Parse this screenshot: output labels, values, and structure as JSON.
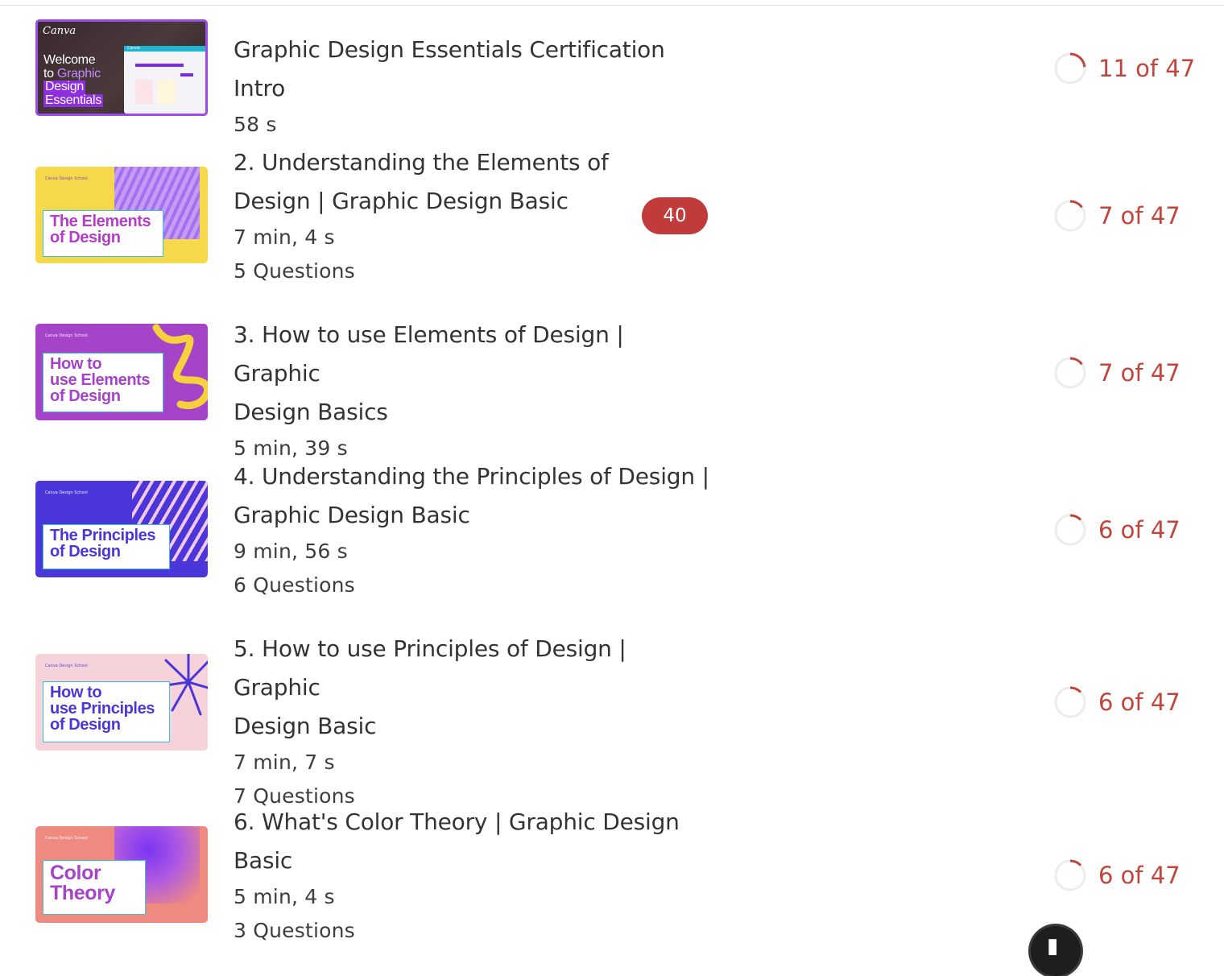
{
  "lessons": [
    {
      "title": "Graphic Design Essentials Certification Intro",
      "duration": "58 s",
      "questions": "",
      "badge": "",
      "progress_text": "11 of 47",
      "progress_fraction": 0.234,
      "thumb": {
        "brand": "Canva",
        "line1": "Welcome",
        "line2a": "to ",
        "line2b": "Graphic",
        "line3": "Design",
        "line4": "Essentials",
        "mini_brand": "Canva"
      }
    },
    {
      "title": "2. Understanding the Elements of Design | Graphic Design Basic",
      "title_line1": "2. Understanding the Elements of",
      "title_line2": "Design | Graphic Design Basic",
      "duration": "7 min, 4 s",
      "questions": "5 Questions",
      "badge": "40",
      "progress_text": "7 of 47",
      "progress_fraction": 0.149,
      "thumb": {
        "school": "Canva Design School",
        "line1": "The Elements",
        "line2": "of Design",
        "bg": "#f6d94b",
        "text_color": "#b33dc6"
      }
    },
    {
      "title_line1": "3. How to use Elements of Design | Graphic",
      "title_line2": "Design Basics",
      "duration": "5 min, 39 s",
      "questions": "",
      "badge": "",
      "progress_text": "7 of 47",
      "progress_fraction": 0.149,
      "thumb": {
        "school": "Canva Design School",
        "line1": "How to",
        "line2": "use Elements",
        "line3": "of Design",
        "bg": "#a543c9",
        "text_color": "#a543c9"
      }
    },
    {
      "title_line1": "4. Understanding the Principles of Design |",
      "title_line2": "Graphic Design Basic",
      "duration": "9 min, 56 s",
      "questions": "6 Questions",
      "badge": "",
      "progress_text": "6 of 47",
      "progress_fraction": 0.128,
      "thumb": {
        "school": "Canva Design School",
        "line1": "The Principles",
        "line2": "of Design",
        "bg": "#4b36d9",
        "text_color": "#4b36d9"
      }
    },
    {
      "title_line1": "5. How to use Principles of Design | Graphic",
      "title_line2": "Design Basic",
      "duration": "7 min, 7 s",
      "questions": "7 Questions",
      "badge": "",
      "progress_text": "6 of 47",
      "progress_fraction": 0.128,
      "thumb": {
        "school": "Canva Design School",
        "line1": "How to",
        "line2": "use Principles",
        "line3": "of Design",
        "bg": "#f6d3da",
        "text_color": "#4b36d9"
      }
    },
    {
      "title_line1": "6. What's Color Theory | Graphic Design",
      "title_line2": "Basic",
      "duration": "5 min, 4 s",
      "questions": "3 Questions",
      "badge": "",
      "progress_text": "6 of 47",
      "progress_fraction": 0.128,
      "thumb": {
        "school": "Canva Design School",
        "line1": "Color",
        "line2": "Theory",
        "bg": "#ef8a80",
        "text_color": "#a543c9"
      }
    }
  ],
  "colors": {
    "accent": "#c0453c",
    "badge_bg": "#c13b3b",
    "text": "#333333"
  },
  "floating_button_icon": "chat-launcher-icon"
}
